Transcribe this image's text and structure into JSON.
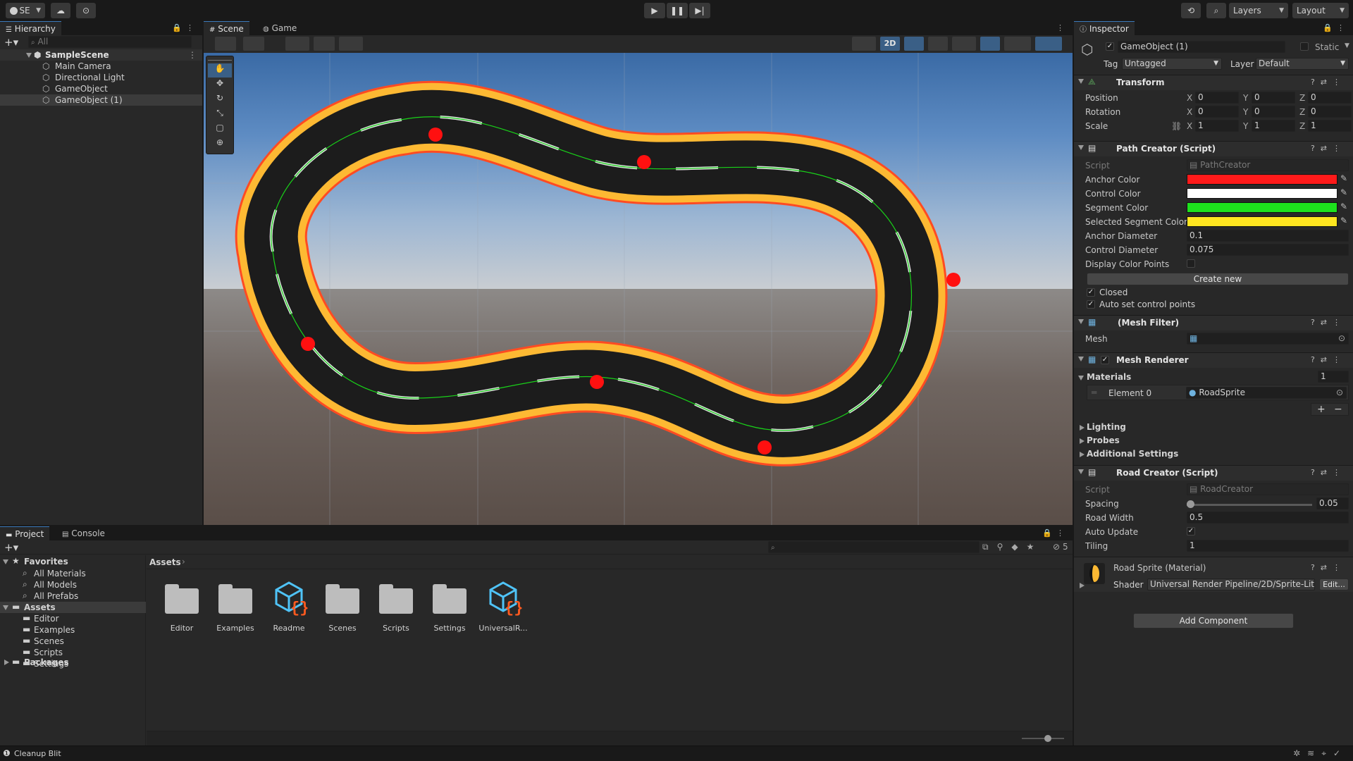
{
  "topbar": {
    "account_label": "SE",
    "layers_label": "Layers",
    "layout_label": "Layout"
  },
  "hierarchy": {
    "tab": "Hierarchy",
    "search_placeholder": "All",
    "scene_name": "SampleScene",
    "items": [
      "Main Camera",
      "Directional Light",
      "GameObject",
      "GameObject (1)"
    ],
    "selected_index": 3
  },
  "scene_view": {
    "tabs": [
      "Scene",
      "Game"
    ],
    "active_tab": "Scene",
    "mode_2d_label": "2D",
    "anchor_color": "#ff1010",
    "road_edge_color": "#fdb933",
    "road_color": "#1c1c1c",
    "path_line_color": "#19d219"
  },
  "inspector": {
    "tab": "Inspector",
    "object_name": "GameObject (1)",
    "static_label": "Static",
    "tag_label": "Tag",
    "tag_value": "Untagged",
    "layer_label": "Layer",
    "layer_value": "Default",
    "transform": {
      "title": "Transform",
      "rows": [
        {
          "label": "Position",
          "x": "0",
          "y": "0",
          "z": "0"
        },
        {
          "label": "Rotation",
          "x": "0",
          "y": "0",
          "z": "0"
        },
        {
          "label": "Scale",
          "x": "1",
          "y": "1",
          "z": "1"
        }
      ]
    },
    "path_creator": {
      "title": "Path Creator (Script)",
      "script_label": "Script",
      "script_value": "PathCreator",
      "anchor_color_label": "Anchor Color",
      "anchor_color": "#ff1a1a",
      "control_color_label": "Control Color",
      "control_color": "#ffffff",
      "segment_color_label": "Segment Color",
      "segment_color": "#1de21d",
      "selected_segment_color_label": "Selected Segment Color",
      "selected_segment_color": "#ffe620",
      "anchor_diameter_label": "Anchor Diameter",
      "anchor_diameter": "0.1",
      "control_diameter_label": "Control Diameter",
      "control_diameter": "0.075",
      "display_color_points_label": "Display Color Points",
      "create_new_label": "Create new",
      "closed_label": "Closed",
      "auto_set_label": "Auto set control points"
    },
    "mesh_filter": {
      "title": "(Mesh Filter)",
      "mesh_label": "Mesh"
    },
    "mesh_renderer": {
      "title": "Mesh Renderer",
      "materials_label": "Materials",
      "materials_count": "1",
      "element_label": "Element 0",
      "element_value": "RoadSprite",
      "lighting_label": "Lighting",
      "probes_label": "Probes",
      "additional_label": "Additional Settings"
    },
    "road_creator": {
      "title": "Road Creator (Script)",
      "script_label": "Script",
      "script_value": "RoadCreator",
      "spacing_label": "Spacing",
      "spacing_value": "0.05",
      "spacing_fraction": 0.0,
      "road_width_label": "Road Width",
      "road_width": "0.5",
      "auto_update_label": "Auto Update",
      "tiling_label": "Tiling",
      "tiling": "1"
    },
    "material": {
      "title": "Road Sprite (Material)",
      "shader_label": "Shader",
      "shader_value": "Universal Render Pipeline/2D/Sprite-Lit",
      "edit_label": "Edit..."
    },
    "add_component_label": "Add Component"
  },
  "project": {
    "tabs": [
      "Project",
      "Console"
    ],
    "favorites_label": "Favorites",
    "favorites": [
      "All Materials",
      "All Models",
      "All Prefabs"
    ],
    "assets_label": "Assets",
    "asset_folders": [
      "Editor",
      "Examples",
      "Scenes",
      "Scripts",
      "Settings"
    ],
    "packages_label": "Packages",
    "breadcrumb": "Assets",
    "hidden_count": "5",
    "assets": [
      {
        "name": "Editor",
        "kind": "folder"
      },
      {
        "name": "Examples",
        "kind": "folder"
      },
      {
        "name": "Readme",
        "kind": "package"
      },
      {
        "name": "Scenes",
        "kind": "folder"
      },
      {
        "name": "Scripts",
        "kind": "folder"
      },
      {
        "name": "Settings",
        "kind": "folder"
      },
      {
        "name": "UniversalR...",
        "kind": "package"
      }
    ]
  },
  "statusbar": {
    "message": "Cleanup Blit"
  }
}
